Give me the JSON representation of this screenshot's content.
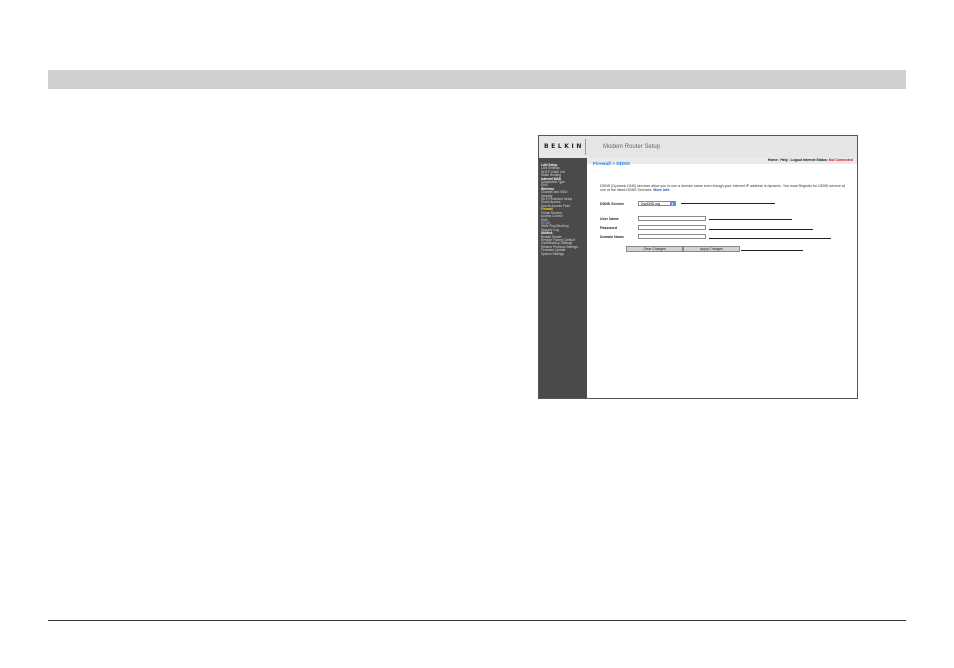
{
  "router_ui": {
    "brand": "BELKIN",
    "app_title": "Modem Router Setup",
    "nav": {
      "home": "Home",
      "help": "Help",
      "logout": "Logout",
      "internet_status_label": "Internet Status:",
      "internet_status_value": "Not Connected"
    },
    "sidebar": {
      "items": [
        "LAN Setup",
        "LAN Settings",
        "DHCP Client List",
        "Static Routing",
        "Internet WAN",
        "Connection Type",
        "DNS",
        "Wireless",
        "Channel and SSID",
        "Security",
        "Wi-Fi Protected Setup",
        "Guest Access",
        "Use as Access Point",
        "Firewall",
        "Virtual Servers",
        "Access Control",
        "DMZ",
        "DDNS",
        "WAN Ping Blocking",
        "Security Log",
        "Utilities",
        "Restart Router",
        "Restore Factory Default",
        "Save/Backup Settings",
        "Restore Previous Settings",
        "Firmware Update",
        "System Settings"
      ]
    },
    "page_heading": "Firewall > DDNS",
    "description": "DDNS (Dynamic DNS) services allow you to use a domain name even though your Internet IP address is dynamic. You must Register for DDNS service at one of the listed DDNS Services.",
    "more_info": "More Info",
    "form": {
      "ddns_service_label": "DDNS Service",
      "ddns_service_value": "DynDNS.org",
      "username_label": "User Name",
      "password_label": "Password",
      "domain_name_label": "Domain Name",
      "clear_button": "Clear Changes",
      "apply_button": "Apply Changes"
    }
  },
  "colors": {
    "band": "#cfcfcf",
    "sidebar_bg": "#4a4a4a",
    "heading_blue": "#2a7fd4",
    "active_yellow": "#ffd21a",
    "status_red": "#d01010"
  }
}
